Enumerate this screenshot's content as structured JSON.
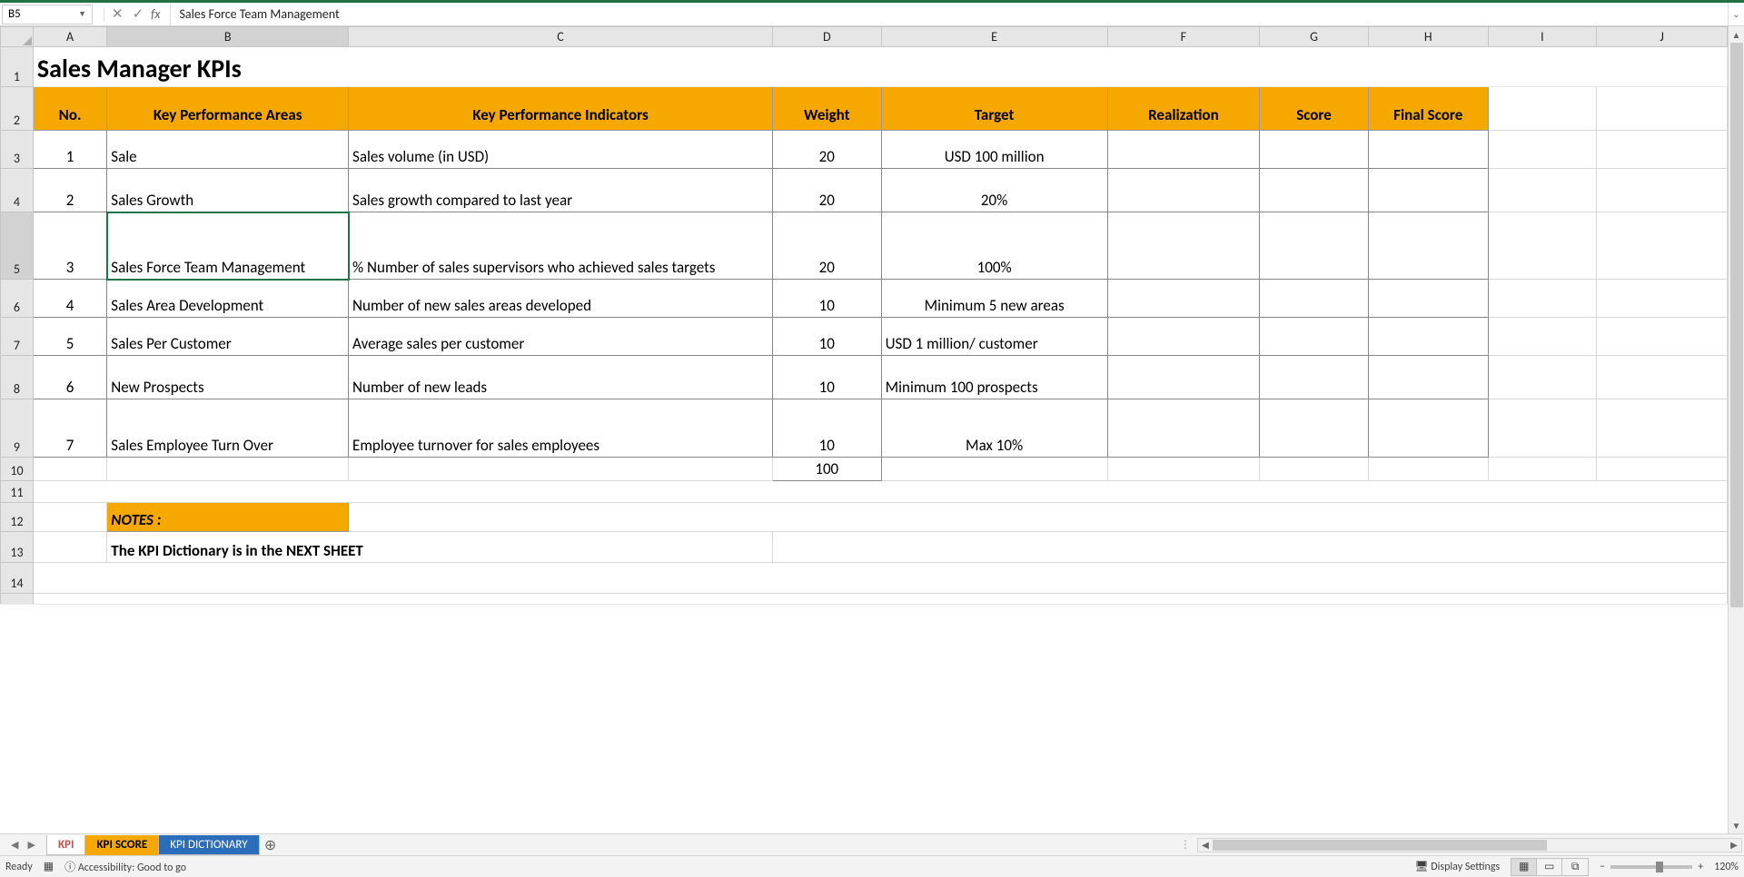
{
  "formula_bar": {
    "cell_ref": "B5",
    "formula": "Sales Force Team Management"
  },
  "columns": [
    "A",
    "B",
    "C",
    "D",
    "E",
    "F",
    "G",
    "H",
    "I",
    "J"
  ],
  "title": "Sales Manager KPIs",
  "headers": {
    "no": "No.",
    "kpa": "Key Performance Areas",
    "kpi": "Key Performance Indicators",
    "weight": "Weight",
    "target": "Target",
    "realization": "Realization",
    "score": "Score",
    "final": "Final Score"
  },
  "rows": [
    {
      "no": "1",
      "kpa": "Sale",
      "kpi": "Sales volume (in USD)",
      "weight": "20",
      "target": "USD 100 million",
      "realization": "",
      "score": "",
      "final": ""
    },
    {
      "no": "2",
      "kpa": "Sales Growth",
      "kpi": "Sales growth compared to last year",
      "weight": "20",
      "target": "20%",
      "realization": "",
      "score": "",
      "final": ""
    },
    {
      "no": "3",
      "kpa": "Sales Force Team Management",
      "kpi": "% Number of sales supervisors who achieved sales targets",
      "weight": "20",
      "target": "100%",
      "realization": "",
      "score": "",
      "final": ""
    },
    {
      "no": "4",
      "kpa": "Sales Area Development",
      "kpi": "Number of new sales areas developed",
      "weight": "10",
      "target": "Minimum 5 new areas",
      "realization": "",
      "score": "",
      "final": ""
    },
    {
      "no": "5",
      "kpa": "Sales Per Customer",
      "kpi": "Average sales per customer",
      "weight": "10",
      "target": "USD 1 million/ customer",
      "realization": "",
      "score": "",
      "final": ""
    },
    {
      "no": "6",
      "kpa": "New Prospects",
      "kpi": "Number of new leads",
      "weight": "10",
      "target": "Minimum 100 prospects",
      "realization": "",
      "score": "",
      "final": ""
    },
    {
      "no": "7",
      "kpa": "Sales Employee Turn Over",
      "kpi": "Employee turnover for sales employees",
      "weight": "10",
      "target": "Max 10%",
      "realization": "",
      "score": "",
      "final": ""
    }
  ],
  "weight_total": "100",
  "notes_label": "NOTES :",
  "notes_text": "The KPI Dictionary is in the NEXT SHEET",
  "tabs": {
    "kpi": "KPI",
    "score": "KPI SCORE",
    "dict": "KPI DICTIONARY"
  },
  "status": {
    "ready": "Ready",
    "accessibility": "Accessibility: Good to go",
    "display": "Display Settings",
    "zoom": "120%"
  }
}
